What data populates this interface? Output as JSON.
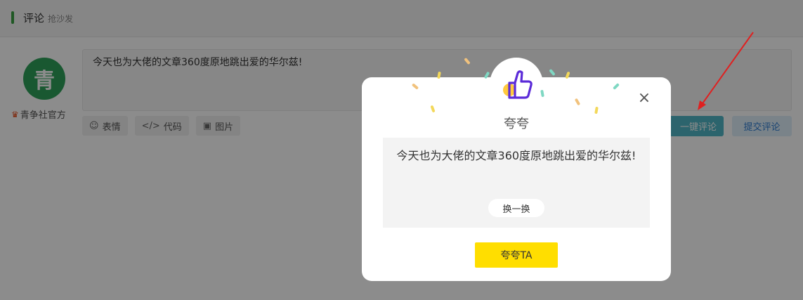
{
  "section": {
    "title": "评论",
    "subtitle": "抢沙发"
  },
  "user": {
    "avatar_char": "青",
    "name": "青争社官方"
  },
  "comment": {
    "text": "今天也为大佬的文章360度原地跳出爱的华尔兹!"
  },
  "toolbar": {
    "emoji_label": "表情",
    "code_label": "代码",
    "image_label": "图片",
    "one_click_label": "一键评论",
    "submit_label": "提交评论"
  },
  "modal": {
    "title": "夸夸",
    "phrase": "今天也为大佬的文章360度原地跳出爱的华尔兹!",
    "swap_label": "换一换",
    "praise_label": "夸夸TA",
    "close_glyph": "×"
  },
  "colors": {
    "accent_yellow": "#ffde00",
    "thumb_purple": "#5b2bd8",
    "brand_green": "#2fa05a"
  }
}
